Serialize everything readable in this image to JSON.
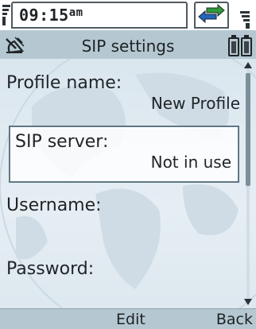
{
  "status_bar": {
    "time": "09:15",
    "ampm": "am",
    "icons": [
      "signal-left-icon",
      "data-transfer-icon",
      "signal-right-icon"
    ]
  },
  "title_bar": {
    "title": "SIP settings",
    "icons": [
      "satellite-icon",
      "battery-icon"
    ]
  },
  "fields": [
    {
      "label": "Profile name:",
      "value": "New Profile"
    },
    {
      "label": "SIP server:",
      "value": "Not in use",
      "selected": true
    },
    {
      "label": "Username:",
      "value": ""
    },
    {
      "label": "Password:",
      "value": ""
    }
  ],
  "softkeys": {
    "left": "",
    "center": "Edit",
    "right": "Back"
  },
  "colors": {
    "title_bar": "#b5c8d2",
    "content_bg": "#dae6ee",
    "selection_border": "#5f7785",
    "text": "#1f2427"
  }
}
